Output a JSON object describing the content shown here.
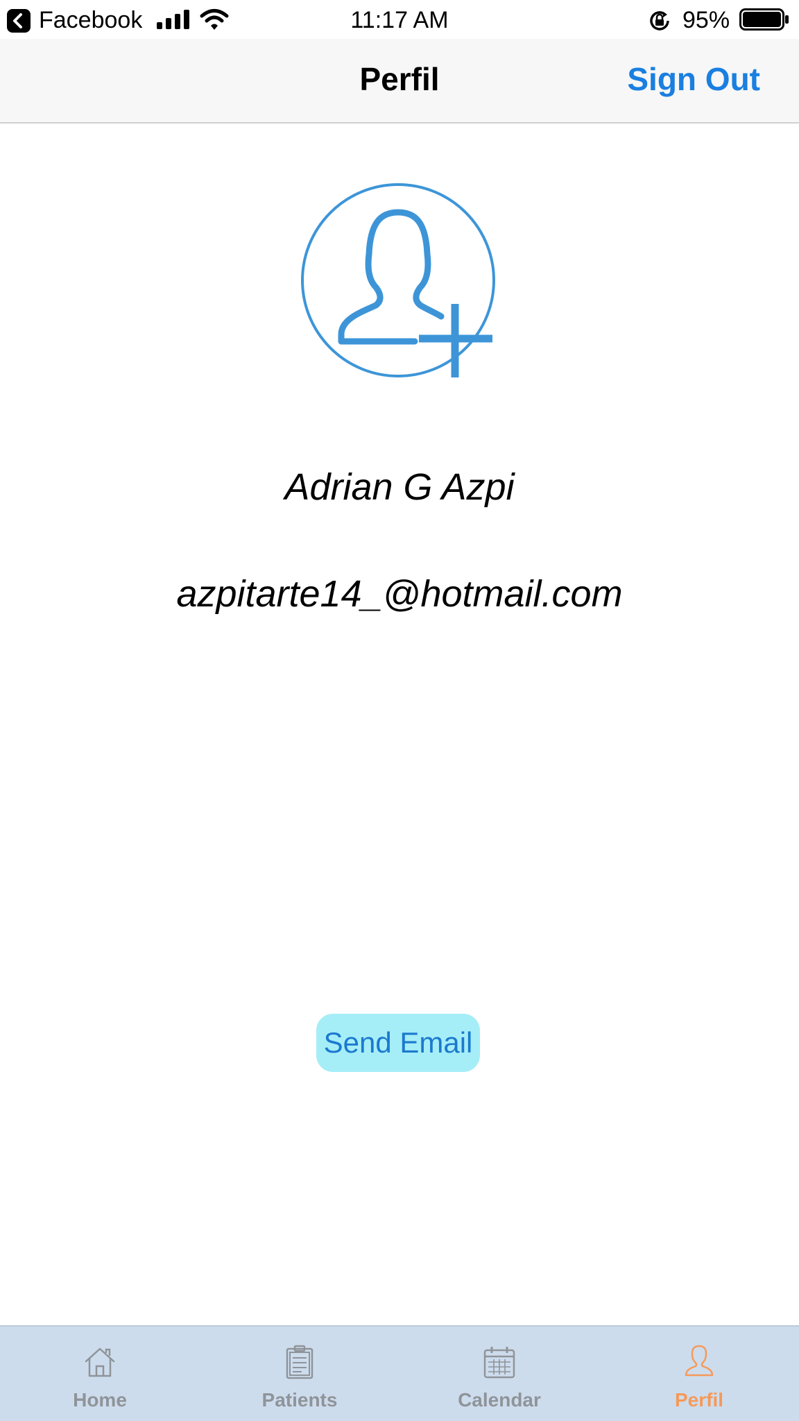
{
  "status_bar": {
    "back_app": "Facebook",
    "time": "11:17 AM",
    "battery": "95%",
    "icons": [
      "back-arrow-icon",
      "signal-bars-icon",
      "wifi-icon",
      "rotation-lock-icon",
      "battery-icon"
    ]
  },
  "nav": {
    "title": "Perfil",
    "action": "Sign Out"
  },
  "profile": {
    "avatar_icon": "add-user-icon",
    "name": "Adrian G Azpi",
    "email": "azpitarte14_@hotmail.com"
  },
  "actions": {
    "send_email": "Send Email"
  },
  "tabs": [
    {
      "label": "Home",
      "icon": "home-icon",
      "active": false
    },
    {
      "label": "Patients",
      "icon": "clipboard-icon",
      "active": false
    },
    {
      "label": "Calendar",
      "icon": "calendar-icon",
      "active": false
    },
    {
      "label": "Perfil",
      "icon": "user-icon",
      "active": true
    }
  ],
  "colors": {
    "accent_blue": "#1a7fe0",
    "avatar_blue": "#3d95d8",
    "button_bg": "#a6eef7",
    "button_text": "#1b79cf",
    "tab_bar_bg": "#cddced",
    "tab_inactive": "#8f9499",
    "tab_active": "#f59a5a"
  }
}
